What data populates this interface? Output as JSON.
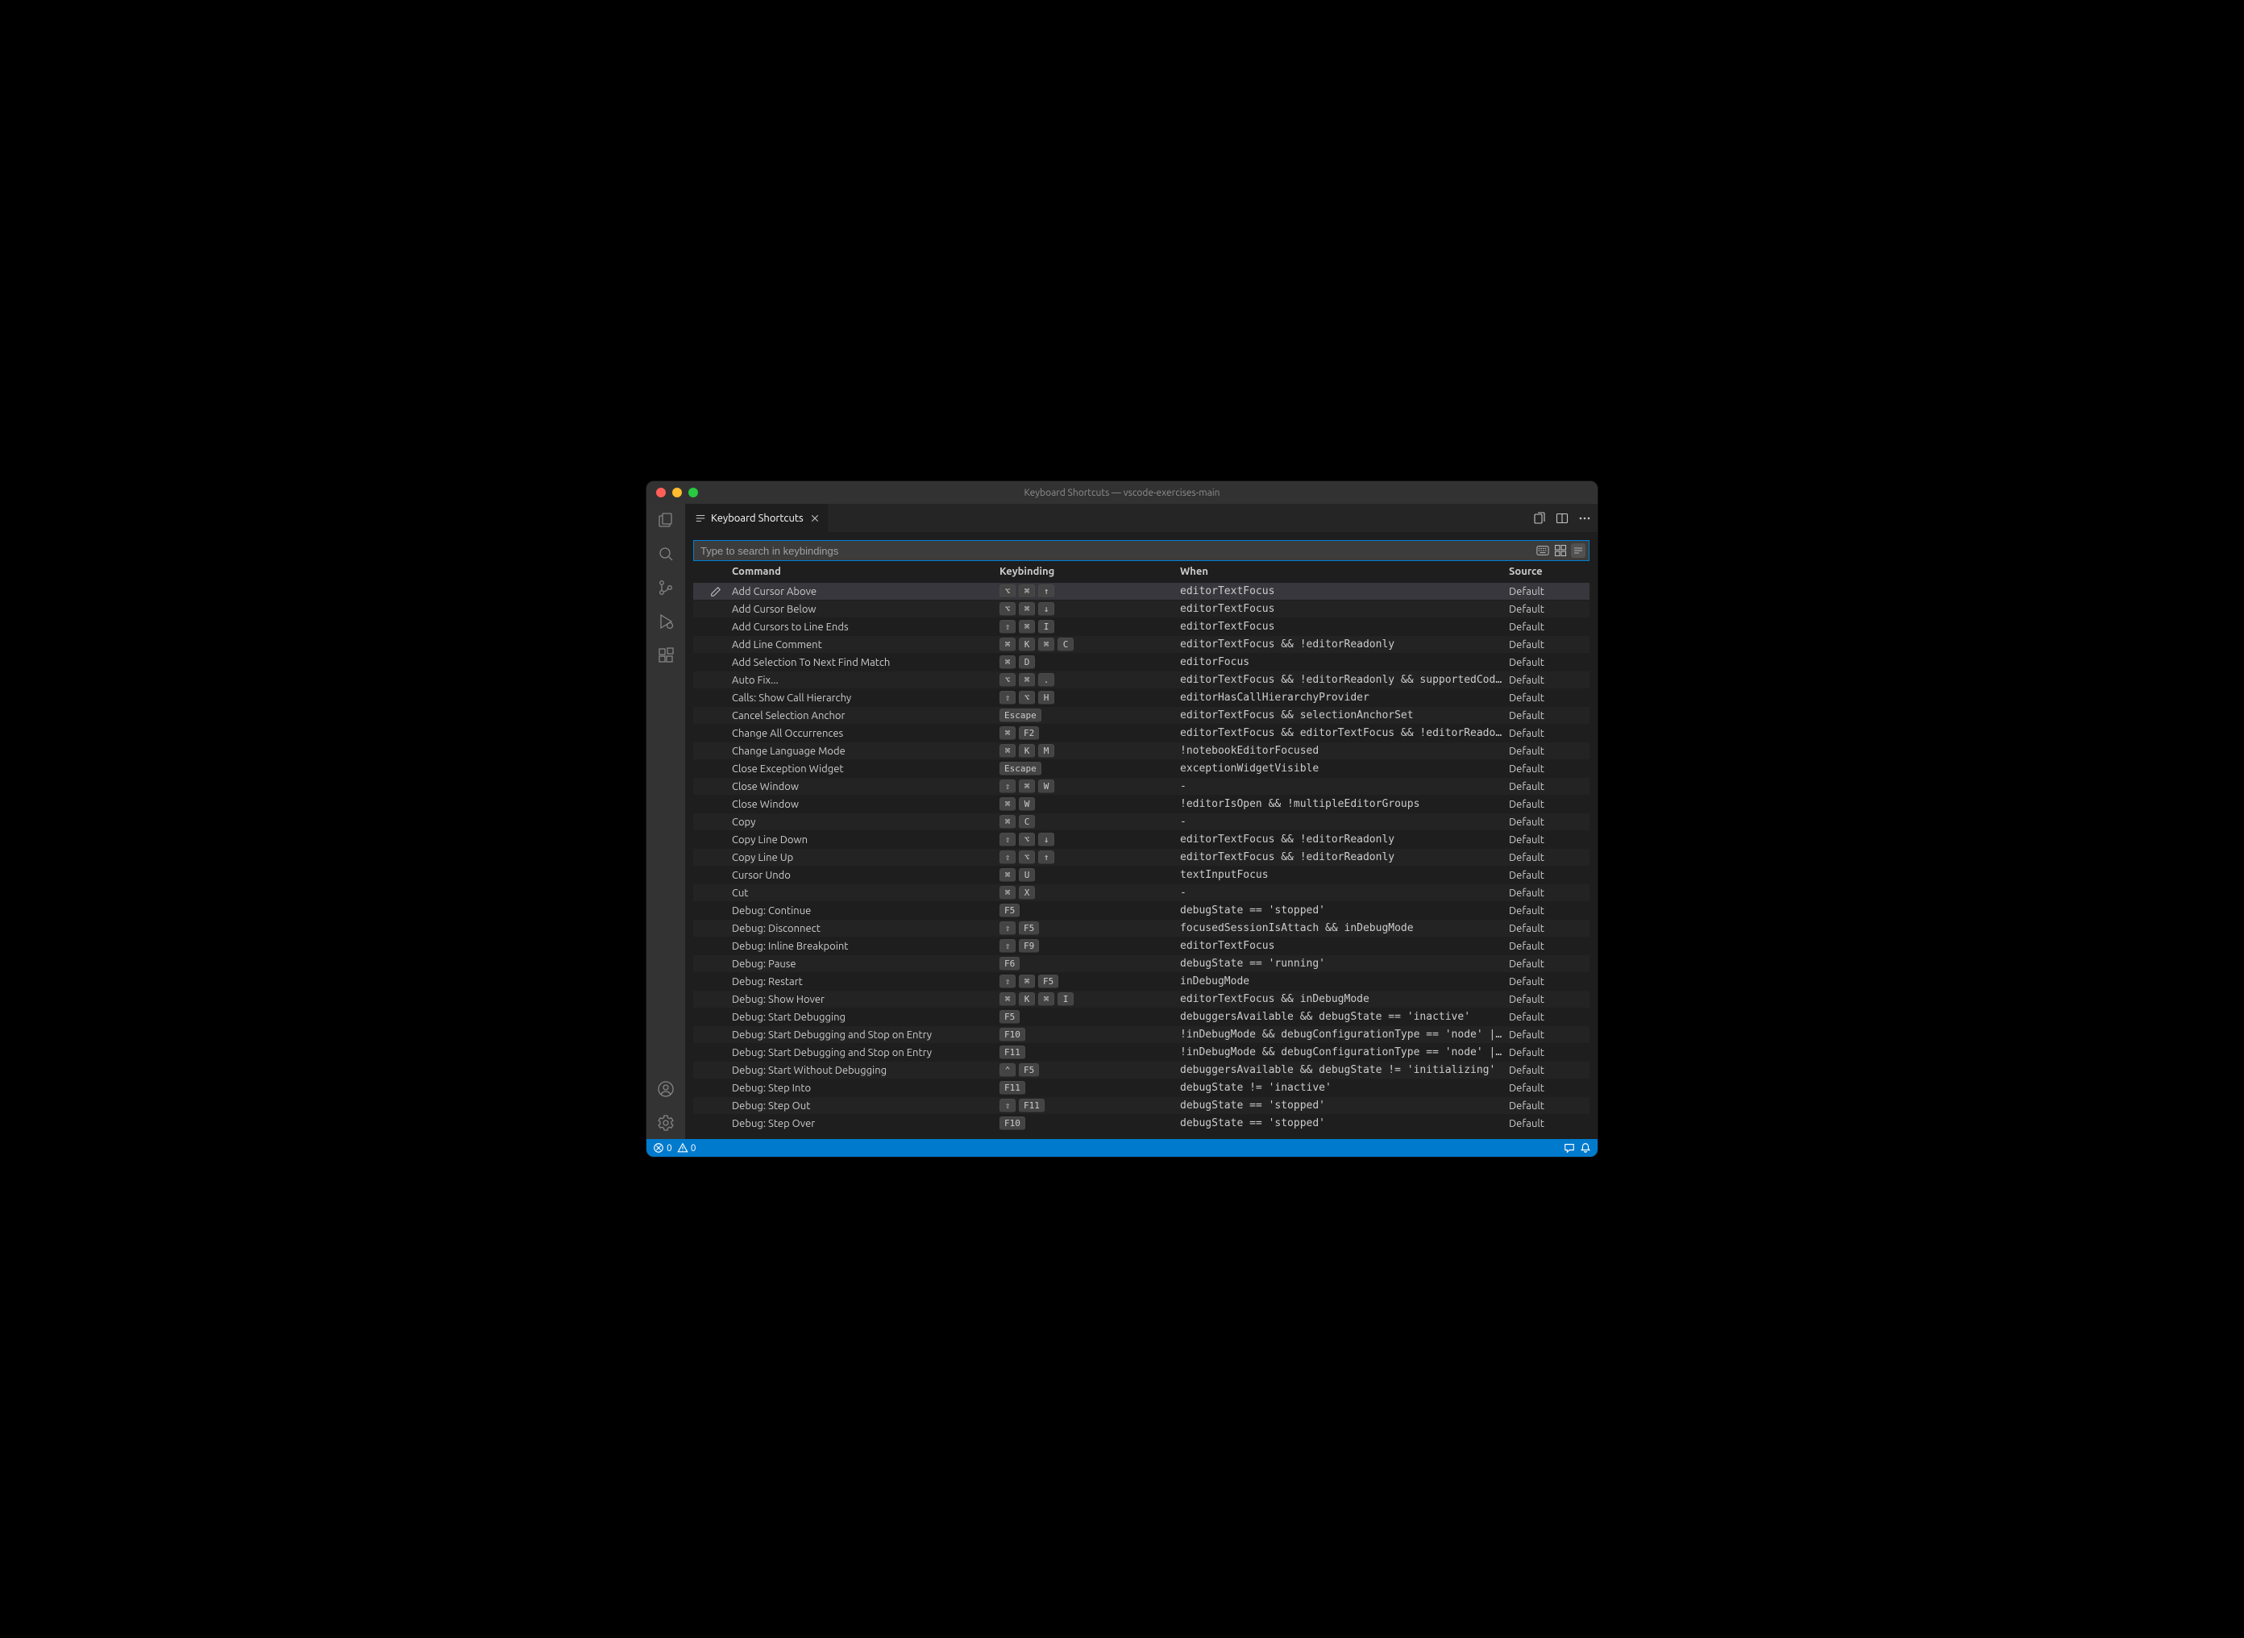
{
  "title": "Keyboard Shortcuts — vscode-exercises-main",
  "tab_label": "Keyboard Shortcuts",
  "search_placeholder": "Type to search in keybindings",
  "headers": {
    "command": "Command",
    "keybinding": "Keybinding",
    "when": "When",
    "source": "Source"
  },
  "status": {
    "errors": "0",
    "warnings": "0"
  },
  "rows": [
    {
      "selected": true,
      "command": "Add Cursor Above",
      "keys": [
        "⌥",
        "⌘",
        "↑"
      ],
      "when": "editorTextFocus",
      "source": "Default"
    },
    {
      "command": "Add Cursor Below",
      "keys": [
        "⌥",
        "⌘",
        "↓"
      ],
      "when": "editorTextFocus",
      "source": "Default"
    },
    {
      "command": "Add Cursors to Line Ends",
      "keys": [
        "⇧",
        "⌘",
        "I"
      ],
      "when": "editorTextFocus",
      "source": "Default"
    },
    {
      "command": "Add Line Comment",
      "keys": [
        "⌘",
        "K",
        "⌘",
        "C"
      ],
      "when": "editorTextFocus && !editorReadonly",
      "source": "Default"
    },
    {
      "command": "Add Selection To Next Find Match",
      "keys": [
        "⌘",
        "D"
      ],
      "when": "editorFocus",
      "source": "Default"
    },
    {
      "command": "Auto Fix...",
      "keys": [
        "⌥",
        "⌘",
        "."
      ],
      "when": "editorTextFocus && !editorReadonly && supportedCodeAction =~…",
      "source": "Default"
    },
    {
      "command": "Calls: Show Call Hierarchy",
      "keys": [
        "⇧",
        "⌥",
        "H"
      ],
      "when": "editorHasCallHierarchyProvider",
      "source": "Default"
    },
    {
      "command": "Cancel Selection Anchor",
      "keys": [
        "Escape"
      ],
      "when": "editorTextFocus && selectionAnchorSet",
      "source": "Default"
    },
    {
      "command": "Change All Occurrences",
      "keys": [
        "⌘",
        "F2"
      ],
      "when": "editorTextFocus && editorTextFocus && !editorReadonly",
      "source": "Default"
    },
    {
      "command": "Change Language Mode",
      "keys": [
        "⌘",
        "K",
        "M"
      ],
      "when": "!notebookEditorFocused",
      "source": "Default"
    },
    {
      "command": "Close Exception Widget",
      "keys": [
        "Escape"
      ],
      "when": "exceptionWidgetVisible",
      "source": "Default"
    },
    {
      "command": "Close Window",
      "keys": [
        "⇧",
        "⌘",
        "W"
      ],
      "when": "-",
      "source": "Default"
    },
    {
      "command": "Close Window",
      "keys": [
        "⌘",
        "W"
      ],
      "when": "!editorIsOpen && !multipleEditorGroups",
      "source": "Default"
    },
    {
      "command": "Copy",
      "keys": [
        "⌘",
        "C"
      ],
      "when": "-",
      "source": "Default"
    },
    {
      "command": "Copy Line Down",
      "keys": [
        "⇧",
        "⌥",
        "↓"
      ],
      "when": "editorTextFocus && !editorReadonly",
      "source": "Default"
    },
    {
      "command": "Copy Line Up",
      "keys": [
        "⇧",
        "⌥",
        "↑"
      ],
      "when": "editorTextFocus && !editorReadonly",
      "source": "Default"
    },
    {
      "command": "Cursor Undo",
      "keys": [
        "⌘",
        "U"
      ],
      "when": "textInputFocus",
      "source": "Default"
    },
    {
      "command": "Cut",
      "keys": [
        "⌘",
        "X"
      ],
      "when": "-",
      "source": "Default"
    },
    {
      "command": "Debug: Continue",
      "keys": [
        "F5"
      ],
      "when": "debugState == 'stopped'",
      "source": "Default"
    },
    {
      "command": "Debug: Disconnect",
      "keys": [
        "⇧",
        "F5"
      ],
      "when": "focusedSessionIsAttach && inDebugMode",
      "source": "Default"
    },
    {
      "command": "Debug: Inline Breakpoint",
      "keys": [
        "⇧",
        "F9"
      ],
      "when": "editorTextFocus",
      "source": "Default"
    },
    {
      "command": "Debug: Pause",
      "keys": [
        "F6"
      ],
      "when": "debugState == 'running'",
      "source": "Default"
    },
    {
      "command": "Debug: Restart",
      "keys": [
        "⇧",
        "⌘",
        "F5"
      ],
      "when": "inDebugMode",
      "source": "Default"
    },
    {
      "command": "Debug: Show Hover",
      "keys": [
        "⌘",
        "K",
        "⌘",
        "I"
      ],
      "when": "editorTextFocus && inDebugMode",
      "source": "Default"
    },
    {
      "command": "Debug: Start Debugging",
      "keys": [
        "F5"
      ],
      "when": "debuggersAvailable && debugState == 'inactive'",
      "source": "Default"
    },
    {
      "command": "Debug: Start Debugging and Stop on Entry",
      "keys": [
        "F10"
      ],
      "when": "!inDebugMode && debugConfigurationType == 'node' || !inDebug…",
      "source": "Default"
    },
    {
      "command": "Debug: Start Debugging and Stop on Entry",
      "keys": [
        "F11"
      ],
      "when": "!inDebugMode && debugConfigurationType == 'node' || !inDebug…",
      "source": "Default"
    },
    {
      "command": "Debug: Start Without Debugging",
      "keys": [
        "⌃",
        "F5"
      ],
      "when": "debuggersAvailable && debugState != 'initializing'",
      "source": "Default"
    },
    {
      "command": "Debug: Step Into",
      "keys": [
        "F11"
      ],
      "when": "debugState != 'inactive'",
      "source": "Default"
    },
    {
      "command": "Debug: Step Out",
      "keys": [
        "⇧",
        "F11"
      ],
      "when": "debugState == 'stopped'",
      "source": "Default"
    },
    {
      "command": "Debug: Step Over",
      "keys": [
        "F10"
      ],
      "when": "debugState == 'stopped'",
      "source": "Default"
    }
  ]
}
